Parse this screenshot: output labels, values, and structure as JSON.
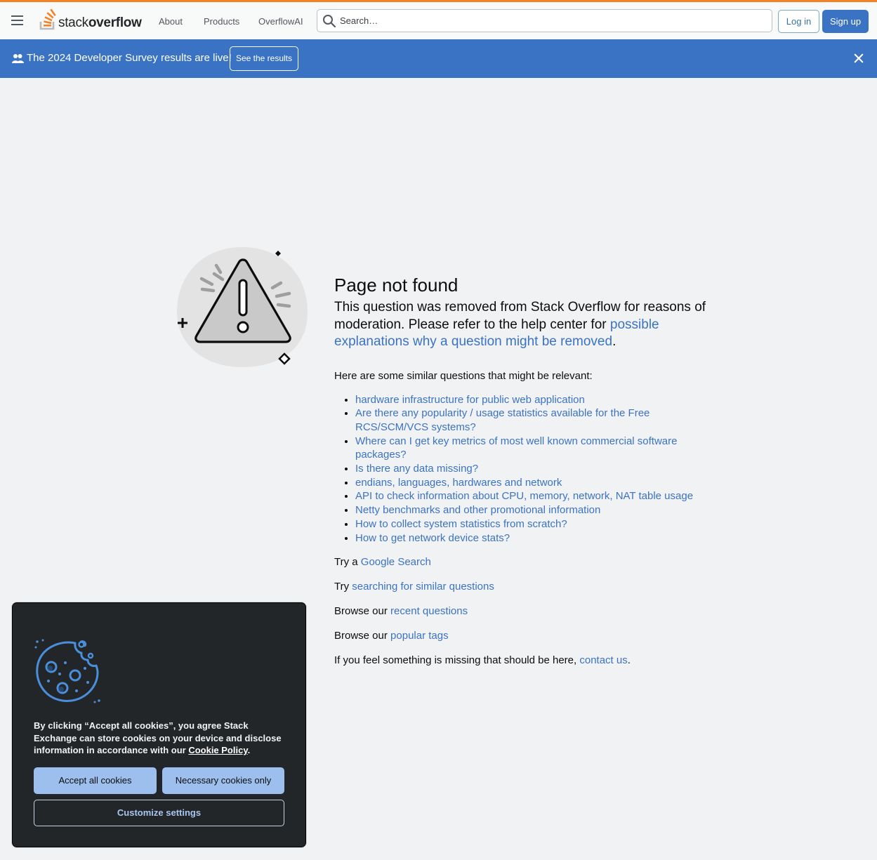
{
  "header": {
    "logo_text_light": "stack",
    "logo_text_bold": "overflow",
    "nav": [
      "About",
      "Products",
      "OverflowAI"
    ],
    "search_placeholder": "Search…",
    "login_label": "Log in",
    "signup_label": "Sign up"
  },
  "banner": {
    "text": "The 2024 Developer Survey results are live!",
    "button_label": "See the results"
  },
  "main": {
    "title": "Page not found",
    "lead_text": "This question was removed from Stack Overflow for reasons of moderation. Please refer to the help center for ",
    "lead_link": "possible explanations why a question might be removed",
    "lead_end": ".",
    "similar_intro": "Here are some similar questions that might be relevant:",
    "similar_questions": [
      "hardware infrastructure for public web application",
      "Are there any popularity / usage statistics available for the Free RCS/SCM/VCS systems?",
      "Where can I get key metrics of most well known commercial software packages?",
      "Is there any data missing?",
      "endians, languages, hardwares and network",
      "API to check information about CPU, memory, network, NAT table usage",
      "Netty benchmarks and other promotional information",
      "How to collect system statistics from scratch?",
      "How to get network device stats?"
    ],
    "try_google_prefix": "Try a ",
    "try_google_link": "Google Search",
    "try_similar_prefix": "Try ",
    "try_similar_link": "searching for similar questions",
    "browse_recent_prefix": "Browse our ",
    "browse_recent_link": "recent questions",
    "browse_tags_prefix": "Browse our ",
    "browse_tags_link": "popular tags",
    "missing_prefix": "If you feel something is missing that should be here, ",
    "missing_link": "contact us",
    "missing_end": "."
  },
  "cookie": {
    "text_before": "By clicking “Accept all cookies”, you agree Stack Exchange can store cookies on your device and disclose information in accordance with our ",
    "policy_link": "Cookie Policy",
    "text_after": ".",
    "accept_label": "Accept all cookies",
    "necessary_label": "Necessary cookies only",
    "customize_label": "Customize settings"
  },
  "colors": {
    "brand_orange": "#f48225",
    "link_blue": "#3b73c4",
    "banner_blue": "#3b73c4",
    "cookie_bg": "#232629"
  },
  "icons": [
    "hamburger-icon",
    "stackoverflow-logo-icon",
    "search-icon",
    "users-icon",
    "close-icon",
    "warning-illustration",
    "cookie-illustration"
  ]
}
